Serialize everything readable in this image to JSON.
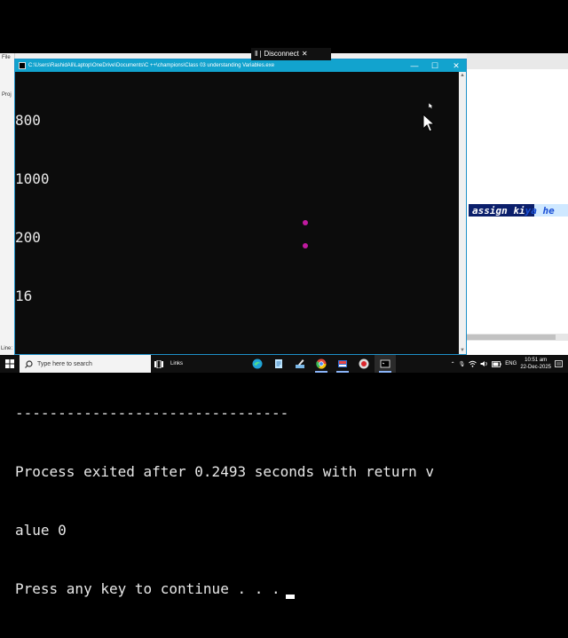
{
  "console": {
    "title": "C:\\Users\\RashidAli\\Laptop\\OneDrive\\Documents\\C ++\\champions\\Class 03 understanding Variables.exe",
    "lines": [
      "800",
      "1000",
      "200",
      "16",
      "",
      "--------------------------------",
      "Process exited after 0.2493 seconds with return v",
      "alue 0",
      "Press any key to continue . . ."
    ],
    "controls": {
      "minimize": "—",
      "maximize": "☐",
      "close": "✕"
    }
  },
  "rdp": {
    "label": "Disconnect"
  },
  "ide": {
    "menu_fragment": "File",
    "side_fragment": "Proj",
    "status_fragment": "Line:",
    "code_selected": " assign ki",
    "code_rest": "ya he"
  },
  "taskbar": {
    "search_placeholder": "Type here to search",
    "links_label": "Links",
    "language": "ENG",
    "time": "10:51 am",
    "date": "22-Dec-2025"
  },
  "colors": {
    "title_bar": "#12a3ce",
    "console_bg": "#0c0c0c",
    "selection": "#0b1f6b",
    "taskbar": "#101010"
  }
}
